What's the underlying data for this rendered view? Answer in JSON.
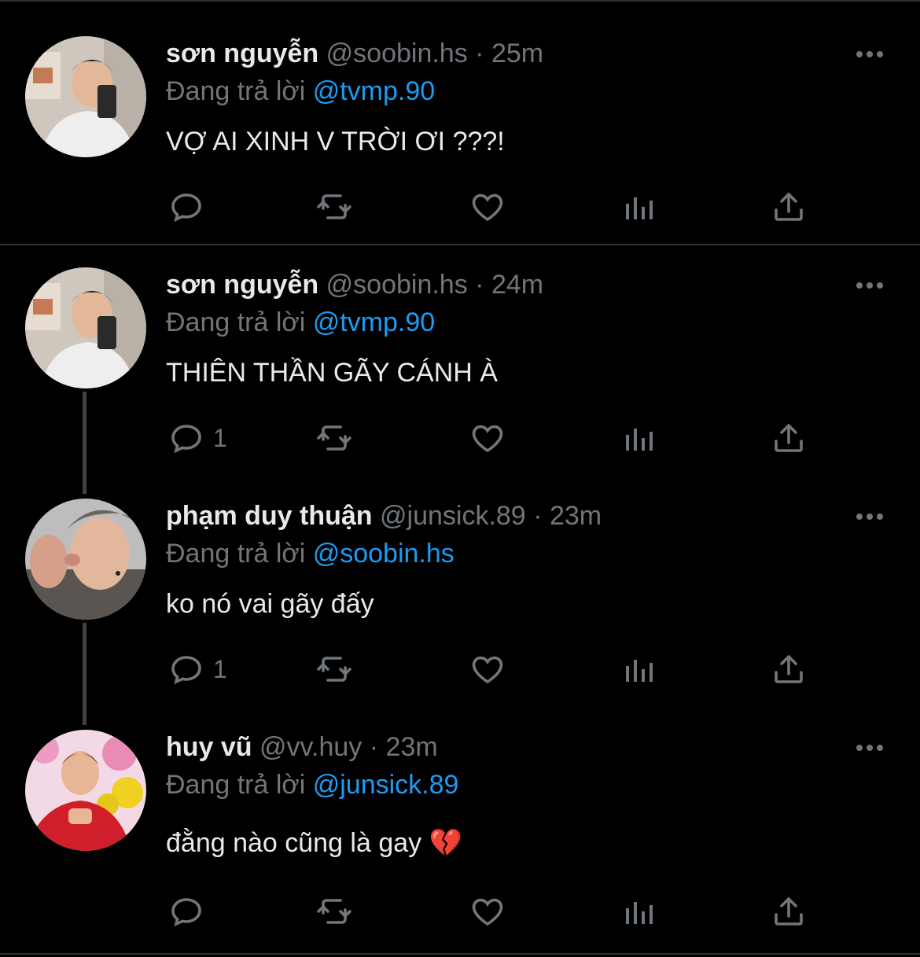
{
  "icons": {
    "reply": "reply-icon",
    "retweet": "retweet-icon",
    "like": "heart-icon",
    "views": "analytics-icon",
    "share": "share-icon",
    "more": "more-icon"
  },
  "tweets": [
    {
      "name": "sơn nguyễn",
      "handle": "@soobin.hs",
      "sep": "·",
      "time": "25m",
      "replying_prefix": "Đang trả lời",
      "replying_to": "@tvmp.90",
      "text": "VỢ AI XINH V TRỜI ƠI ???!",
      "reply_count": ""
    },
    {
      "name": "sơn nguyễn",
      "handle": "@soobin.hs",
      "sep": "·",
      "time": "24m",
      "replying_prefix": "Đang trả lời",
      "replying_to": "@tvmp.90",
      "text": "THIÊN THẦN GÃY CÁNH À",
      "reply_count": "1"
    },
    {
      "name": "phạm duy thuận",
      "handle": "@junsick.89",
      "sep": "·",
      "time": "23m",
      "replying_prefix": "Đang trả lời",
      "replying_to": "@soobin.hs",
      "text": "ko nó vai gãy đấy",
      "reply_count": "1"
    },
    {
      "name": "huy vũ",
      "handle": "@vv.huy",
      "sep": "·",
      "time": "23m",
      "replying_prefix": "Đang trả lời",
      "replying_to": "@junsick.89",
      "text": "đằng nào cũng là gay 💔",
      "reply_count": ""
    }
  ],
  "colors": {
    "background": "#000000",
    "mention": "#1d9bf0",
    "secondary": "#71767b",
    "divider": "#2f3336"
  }
}
